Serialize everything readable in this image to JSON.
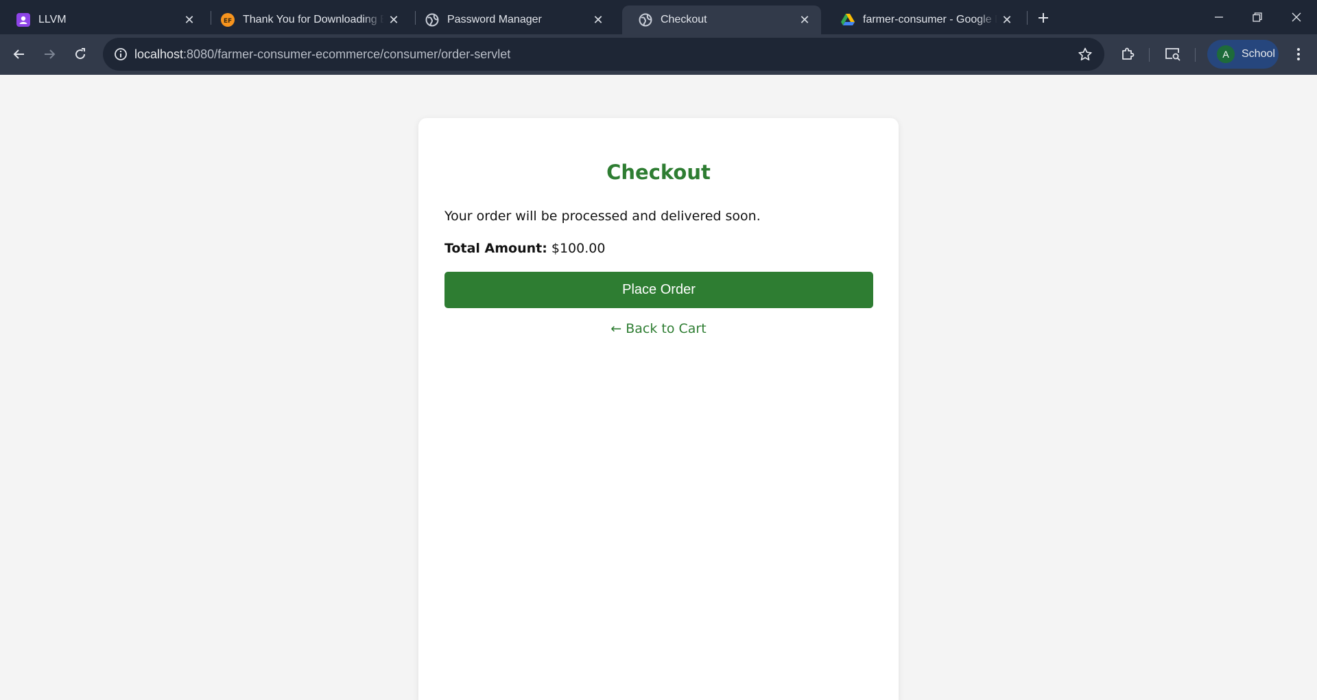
{
  "browser": {
    "tabs": [
      {
        "title": "LLVM",
        "favicon": "purple-contacts-icon",
        "active": false
      },
      {
        "title": "Thank You for Downloading Eclipse",
        "favicon": "eclipse-foundation-icon",
        "active": false
      },
      {
        "title": "Password Manager",
        "favicon": "globe-icon",
        "active": false
      },
      {
        "title": "Checkout",
        "favicon": "globe-icon",
        "active": true
      },
      {
        "title": "farmer-consumer - Google Drive",
        "favicon": "google-drive-icon",
        "active": false
      }
    ],
    "eclipse_badge": "EF",
    "address": {
      "host": "localhost",
      "path": ":8080/farmer-consumer-ecommerce/consumer/order-servlet"
    },
    "profile": {
      "initial": "A",
      "name": "School"
    },
    "colors": {
      "tabstrip": "#1e2635",
      "toolbar": "#323a4a",
      "profile_pill": "#26467d"
    }
  },
  "page": {
    "heading": "Checkout",
    "message": "Your order will be processed and delivered soon.",
    "total_label": "Total Amount:",
    "total_value": "$100.00",
    "place_order_label": "Place Order",
    "back_link_label": "← Back to Cart",
    "colors": {
      "accent": "#2e7d32",
      "background": "#f4f4f4",
      "card": "#ffffff"
    }
  }
}
